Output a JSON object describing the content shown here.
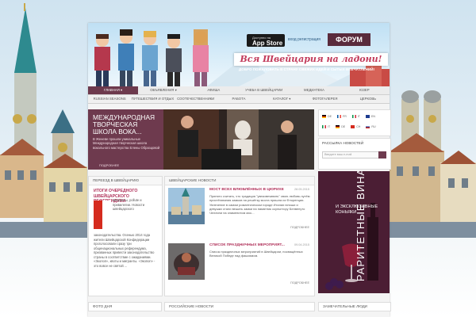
{
  "banner": {
    "store_small": "Доступно на",
    "store_big": "App Store",
    "login": "вход   регистрация",
    "forum": "ФОРУМ",
    "slogan": "Вся Швейцария на ладони!",
    "subslogan": "ДОБРО ПОЖАЛОВАТЬ В СТРАНУ СВЕЖИХ ИДЕЙ И СЫТЫХ ВПЕЧАТЛЕНИЙ!"
  },
  "nav_primary": [
    "Главная ▾",
    "Объявления ▾",
    "Афиша",
    "Учеба в Швейцарии",
    "Медиатека",
    "Юзер"
  ],
  "nav_secondary": [
    "Russian Seasons",
    "Путешествия и отдых",
    "Соотечественники",
    "Работа",
    "Каталог ▾",
    "Фотогалерея",
    "Церковь"
  ],
  "feature": {
    "title": "Международная творческая школа вока...",
    "desc": "В Женеве прошли уникальные Международная творческая школа вокального мастерства Елены Образцовой",
    "more": "Подробнее"
  },
  "flags": {
    "row1": [
      "DE",
      "FR",
      "IT",
      "EN"
    ],
    "row2": [
      "IT",
      "DE",
      "CH",
      "RU"
    ]
  },
  "newsletter": {
    "title": "Рассылка новостей",
    "placeholder": "Введите ваш e-mail"
  },
  "ad": {
    "vertical": "РАРИТЕТНЫЕ ВИНА",
    "text": "и эксклюзивные коньяки"
  },
  "vote": {
    "head": "Переезд в Швейцарию",
    "title": "Итоги очередного швейцарского референдума",
    "text": "Мигранты, pollute и привилегии. Новости швейцарского",
    "text2": "законодательства. Осенью 2014 года жители Швейцарской Конфедерации проголосовали сразу три общенациональных референдума, призванных привести законодательство страны в соответствие с ожиданиями. «Экопоп», квоты и мигранты. «Экопоп» - это вовсе не святой ..."
  },
  "swiss_news": {
    "head": "Швейцарские новости",
    "items": [
      {
        "title": "Мост всех влюблённых в Цюрихе",
        "date": "28.05.2015",
        "text": "Принято считать, что традиция \"увековечивать\" свою любовь путём пристёгивания замков на решётку моста пришла из Флоренции. Увлечение в самом романтическом городе Италии юноши и девушки стали вешать замки на памятник скульптору Бенвенуто Челлини на знаменитом мос...",
        "more": "Подробнее"
      },
      {
        "title": "Список праздничных мероприят...",
        "date": "09.04.2015",
        "text": "Список праздничных мероприятий в Швейцарии, посвящённых Великой Победе над фашизмом.",
        "more": "Подробнее"
      }
    ]
  },
  "bottom": {
    "photo_day": "Фото дня",
    "russian_news": "Российские новости",
    "people": "Замечательные люди"
  },
  "colors": {
    "accent": "#6e3a4e",
    "title_red": "#b0315a",
    "forum": "#5a2b3c"
  }
}
